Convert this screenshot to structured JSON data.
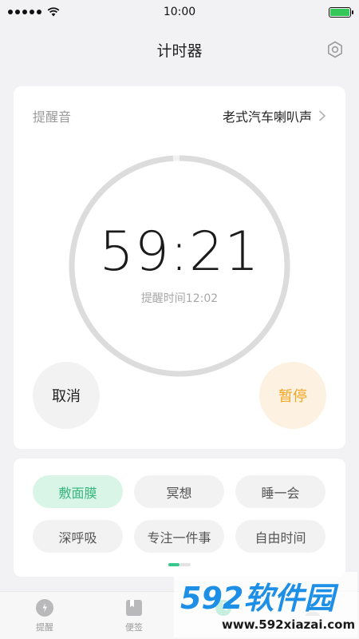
{
  "status_bar": {
    "time": "10:00",
    "battery_color": "#34c759"
  },
  "nav": {
    "title": "计时器",
    "settings_icon": "gear-hex-icon"
  },
  "timer": {
    "sound_label": "提醒音",
    "sound_value": "老式汽车喇叭声",
    "time_remaining": "59:21",
    "remind_text": "提醒时间12:02",
    "progress_fraction": 0.99,
    "cancel_label": "取消",
    "pause_label": "暂停",
    "accent_color": "#f3a524"
  },
  "presets": {
    "items": [
      {
        "label": "敷面膜",
        "active": true
      },
      {
        "label": "冥想",
        "active": false
      },
      {
        "label": "睡一会",
        "active": false
      },
      {
        "label": "深呼吸",
        "active": false
      },
      {
        "label": "专注一件事",
        "active": false
      },
      {
        "label": "自由时间",
        "active": false
      }
    ],
    "active_color": "#38b57b"
  },
  "tabs": [
    {
      "label": "提醒",
      "icon": "clock-reminder-icon"
    },
    {
      "label": "便签",
      "icon": "note-icon"
    },
    {
      "label": "",
      "icon": "timer-icon"
    },
    {
      "label": "",
      "icon": "profile-icon"
    }
  ],
  "watermark": {
    "brand": "592软件园",
    "url": "www.592xiazai.com"
  }
}
